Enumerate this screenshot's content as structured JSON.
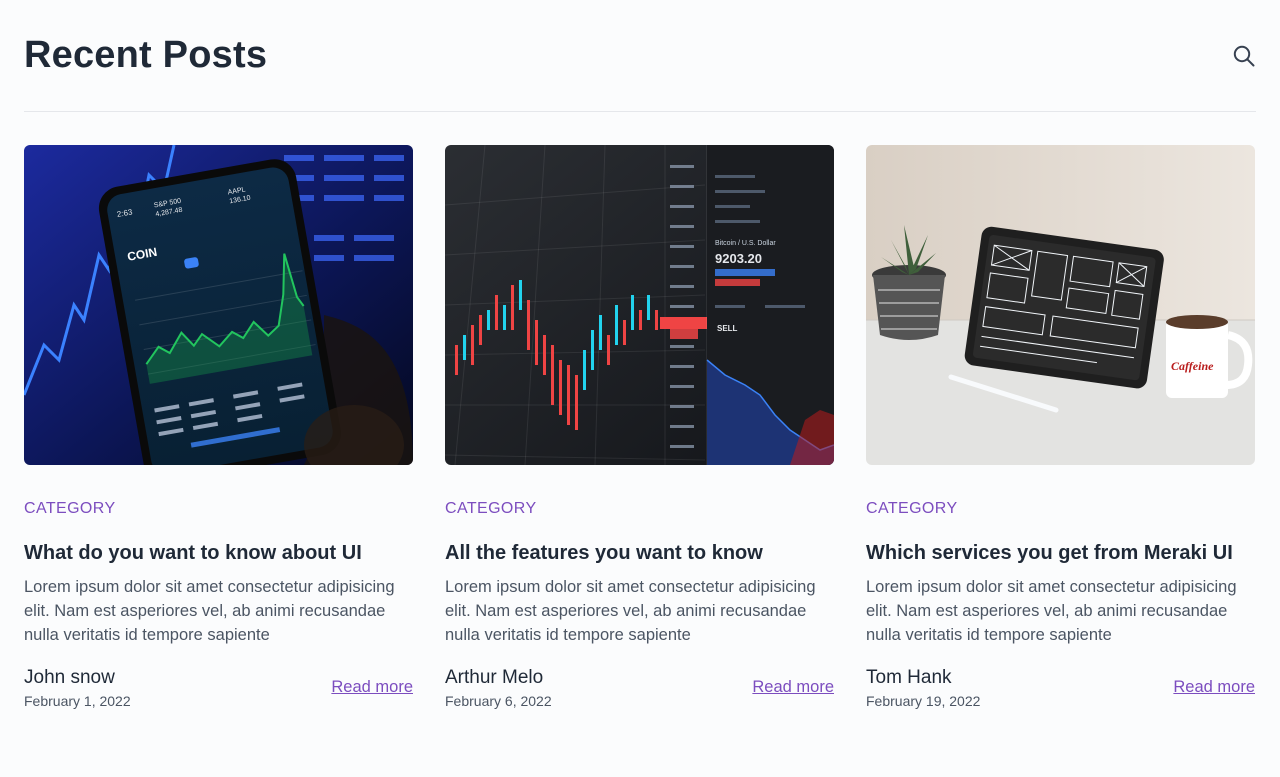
{
  "header": {
    "title": "Recent Posts",
    "search_icon": "search-icon"
  },
  "posts": [
    {
      "category": "CATEGORY",
      "title": "What do you want to know about UI",
      "excerpt": "Lorem ipsum dolor sit amet consectetur adipisicing elit. Nam est asperiores vel, ab animi recusandae nulla veritatis id tempore sapiente",
      "author": "John snow",
      "date": "February 1, 2022",
      "read_more": "Read more",
      "image": {
        "coin": "COIN",
        "ticker_left": "S&P 500",
        "ticker_left_val": "4,287.48",
        "ticker_right": "AAPL",
        "ticker_right_val": "136.10",
        "time": "2:63"
      }
    },
    {
      "category": "CATEGORY",
      "title": "All the features you want to know",
      "excerpt": "Lorem ipsum dolor sit amet consectetur adipisicing elit. Nam est asperiores vel, ab animi recusandae nulla veritatis id tempore sapiente",
      "author": "Arthur Melo",
      "date": "February 6, 2022",
      "read_more": "Read more",
      "image": {
        "price": "9203.20",
        "pair": "Bitcoin / U.S. Dollar",
        "sell": "SELL"
      }
    },
    {
      "category": "CATEGORY",
      "title": "Which services you get from Meraki UI",
      "excerpt": "Lorem ipsum dolor sit amet consectetur adipisicing elit. Nam est asperiores vel, ab animi recusandae nulla veritatis id tempore sapiente",
      "author": "Tom Hank",
      "date": "February 19, 2022",
      "read_more": "Read more",
      "image": {
        "mug_text": "Caffeine"
      }
    }
  ],
  "colors": {
    "accent": "#7c4dbf",
    "title": "#1f2937",
    "body": "#4b5563"
  }
}
